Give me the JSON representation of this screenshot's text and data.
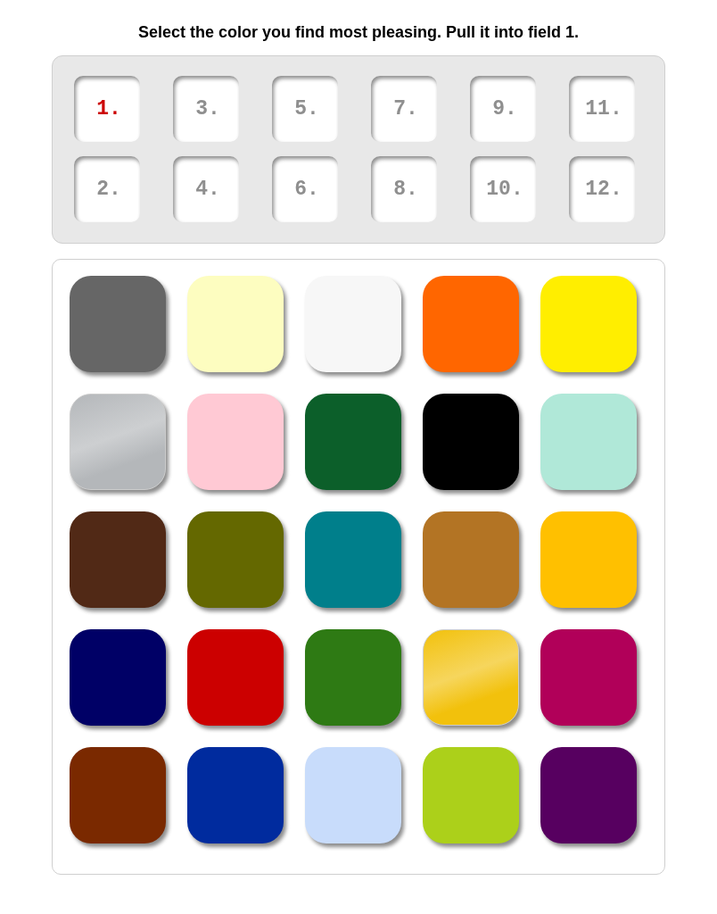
{
  "instruction": "Select the color you find most pleasing. Pull it into field 1.",
  "slots": [
    {
      "label": "1.",
      "selected": true
    },
    {
      "label": "3.",
      "selected": false
    },
    {
      "label": "5.",
      "selected": false
    },
    {
      "label": "7.",
      "selected": false
    },
    {
      "label": "9.",
      "selected": false
    },
    {
      "label": "11.",
      "selected": false
    },
    {
      "label": "2.",
      "selected": false
    },
    {
      "label": "4.",
      "selected": false
    },
    {
      "label": "6.",
      "selected": false
    },
    {
      "label": "8.",
      "selected": false
    },
    {
      "label": "10.",
      "selected": false
    },
    {
      "label": "12.",
      "selected": false
    }
  ],
  "swatches": [
    {
      "kind": "solid",
      "color": "#666666"
    },
    {
      "kind": "solid",
      "color": "#fdfdc0"
    },
    {
      "kind": "solid",
      "color": "#f7f7f7"
    },
    {
      "kind": "solid",
      "color": "#ff6600"
    },
    {
      "kind": "solid",
      "color": "#ffee00"
    },
    {
      "kind": "metallic",
      "color": "#b4b7ba"
    },
    {
      "kind": "solid",
      "color": "#ffc9d4"
    },
    {
      "kind": "solid",
      "color": "#0c5f2a"
    },
    {
      "kind": "solid",
      "color": "#000000"
    },
    {
      "kind": "solid",
      "color": "#b0e8d8"
    },
    {
      "kind": "solid",
      "color": "#512916"
    },
    {
      "kind": "solid",
      "color": "#646800"
    },
    {
      "kind": "solid",
      "color": "#007f8b"
    },
    {
      "kind": "solid",
      "color": "#b37424"
    },
    {
      "kind": "solid",
      "color": "#ffc000"
    },
    {
      "kind": "solid",
      "color": "#000066"
    },
    {
      "kind": "solid",
      "color": "#cc0000"
    },
    {
      "kind": "solid",
      "color": "#2e7a14"
    },
    {
      "kind": "metallic",
      "color": "#f2c10c"
    },
    {
      "kind": "solid",
      "color": "#b10059"
    },
    {
      "kind": "solid",
      "color": "#7a2900"
    },
    {
      "kind": "solid",
      "color": "#002b9e"
    },
    {
      "kind": "solid",
      "color": "#c8dcfb"
    },
    {
      "kind": "solid",
      "color": "#acd01a"
    },
    {
      "kind": "solid",
      "color": "#570060"
    }
  ]
}
